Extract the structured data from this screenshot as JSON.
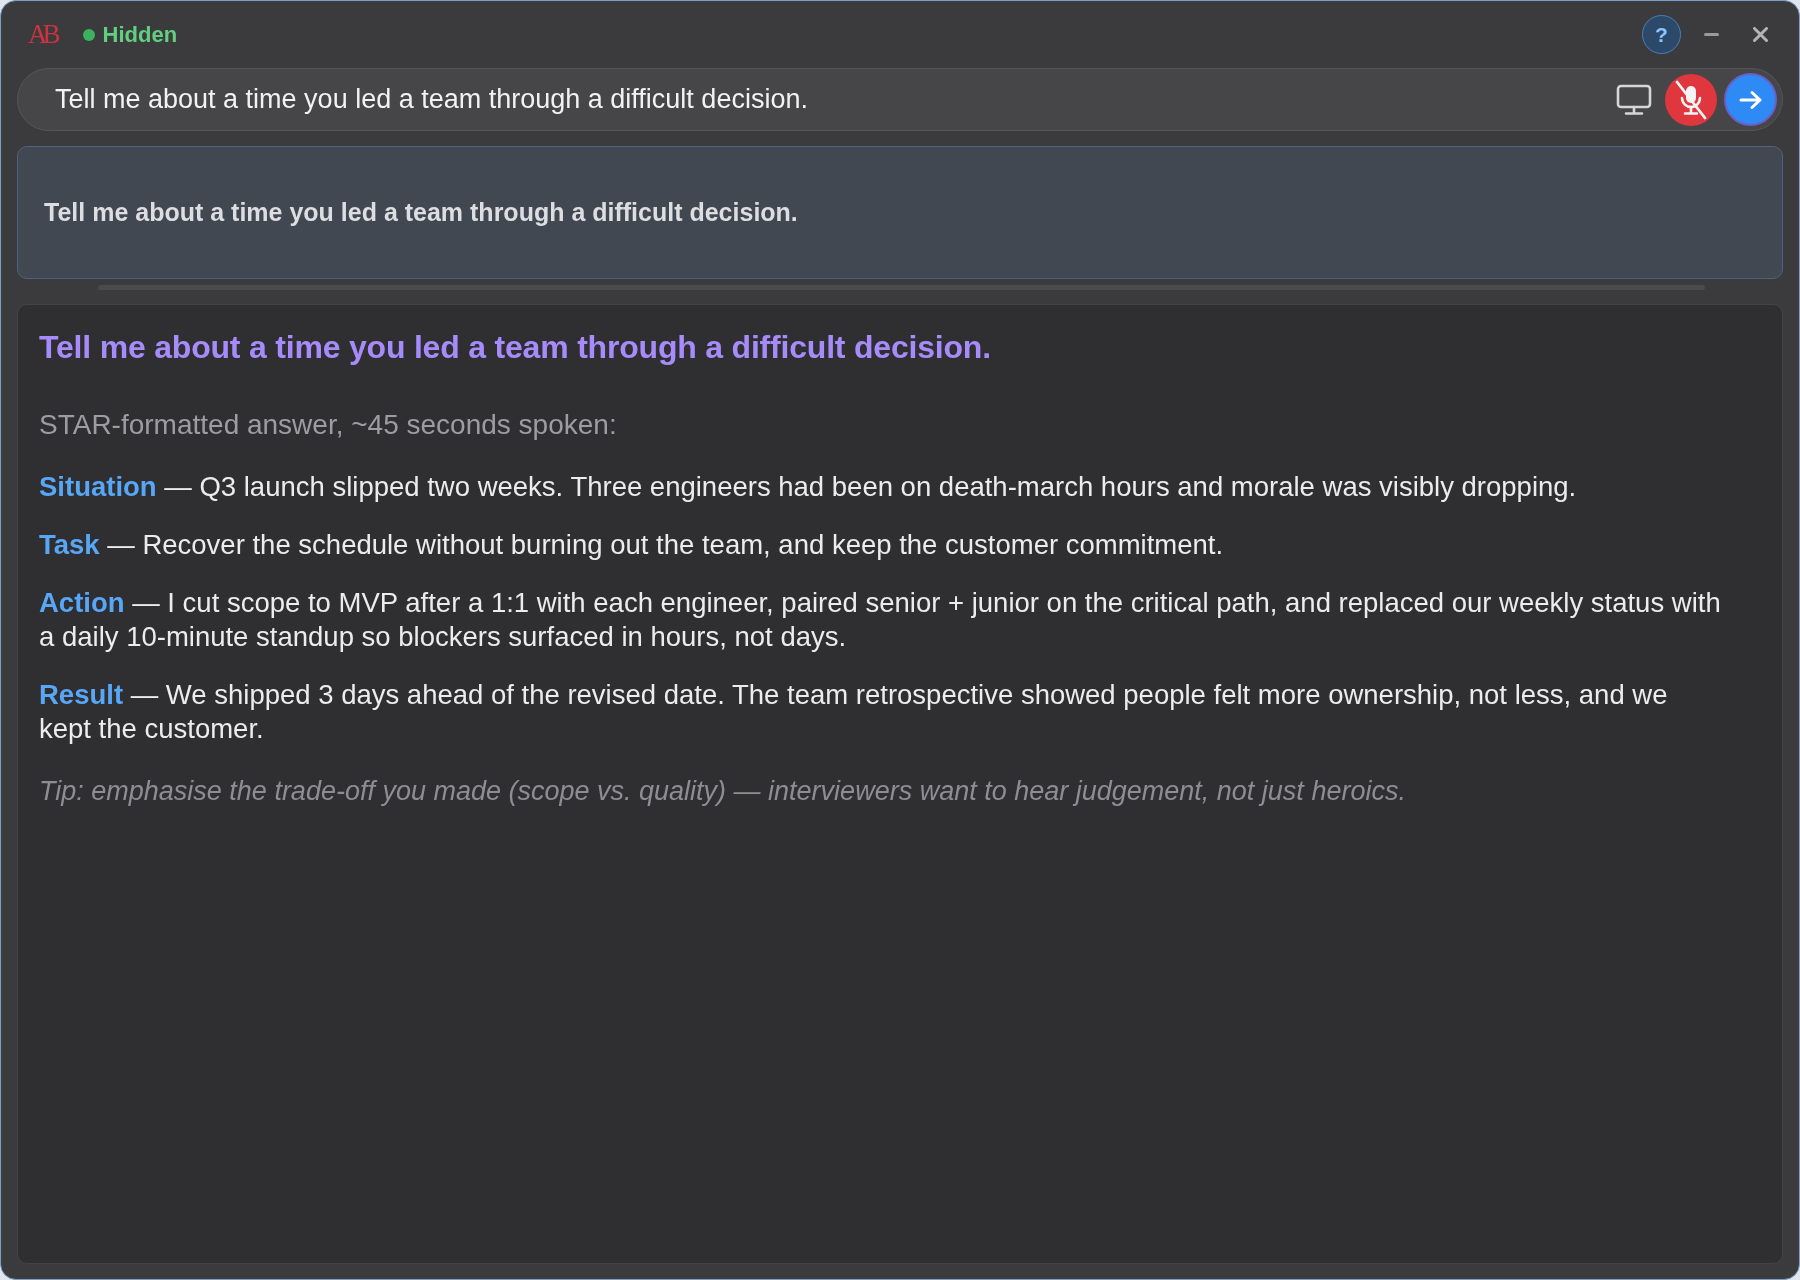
{
  "window": {
    "logo": "AB",
    "status": "Hidden",
    "help_button": "?"
  },
  "prompt_bar": {
    "value": "Tell me about a time you led a team through a difficult decision.",
    "mic_muted": true
  },
  "question_card": {
    "text": "Tell me about a time you led a team through a difficult decision."
  },
  "answer": {
    "title": "Tell me about a time you led a team through a difficult decision.",
    "intro": "STAR-formatted answer, ~45 seconds spoken:",
    "paragraphs": [
      "**Situation** — Q3 launch slipped two weeks. Three engineers had been on death-march hours and morale was visibly dropping.",
      "**Task** — Recover the schedule without burning out the team, and keep the customer commitment.",
      "**Action** — I cut scope to MVP after a 1:1 with each engineer, paired senior + junior on the critical path, and replaced our weekly status with a daily 10-minute standup so blockers surfaced in hours, not days.",
      "**Result** — We shipped 3 days ahead of the revised date. The team retrospective showed people felt more ownership, not less, and we kept the customer."
    ],
    "tip": "Tip: emphasise the trade-off you made (scope vs. quality) — interviewers want to hear judgement, not just heroics."
  }
}
